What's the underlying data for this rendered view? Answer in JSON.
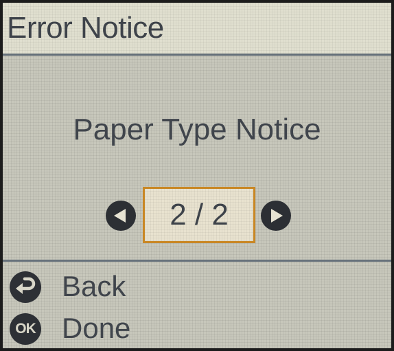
{
  "header": {
    "title": "Error Notice"
  },
  "main": {
    "notice_title": "Paper Type Notice",
    "pager": {
      "text": "2 / 2",
      "prev_icon": "left-arrow-icon",
      "next_icon": "right-arrow-icon"
    }
  },
  "footer": {
    "back": {
      "label": "Back",
      "icon": "back-icon"
    },
    "done": {
      "label": "Done",
      "icon_text": "OK",
      "icon": "ok-icon"
    }
  },
  "colors": {
    "screen_bg": "#c7c7bb",
    "header_bg": "#e0dfcf",
    "divider": "#66717b",
    "highlight_border": "#c98724",
    "text": "#3e434a",
    "icon_fill": "#2c2f34"
  }
}
